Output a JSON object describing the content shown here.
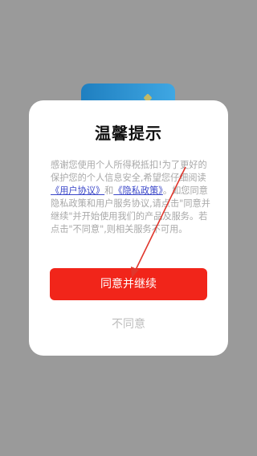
{
  "dialog": {
    "title": "温馨提示",
    "body_part1": "感谢您使用个人所得税抵扣!为了更好的保护您的个人信息安全,希望您仔细阅读",
    "link_user_agreement": "《用户协议》",
    "body_and": "和",
    "link_privacy_policy": "《隐私政策》",
    "body_part2": "。如您同意隐私政策和用户服务协议,请点击\"同意并继续\"并开始使用我们的产品及服务。若点击\"不同意\",则相关服务不可用。",
    "agree_label": "同意并继续",
    "disagree_label": "不同意"
  },
  "colors": {
    "overlay": "#9a9a9a",
    "primary_button": "#f1251a",
    "link": "#3a46c8",
    "annotation_arrow": "#e0362c"
  }
}
